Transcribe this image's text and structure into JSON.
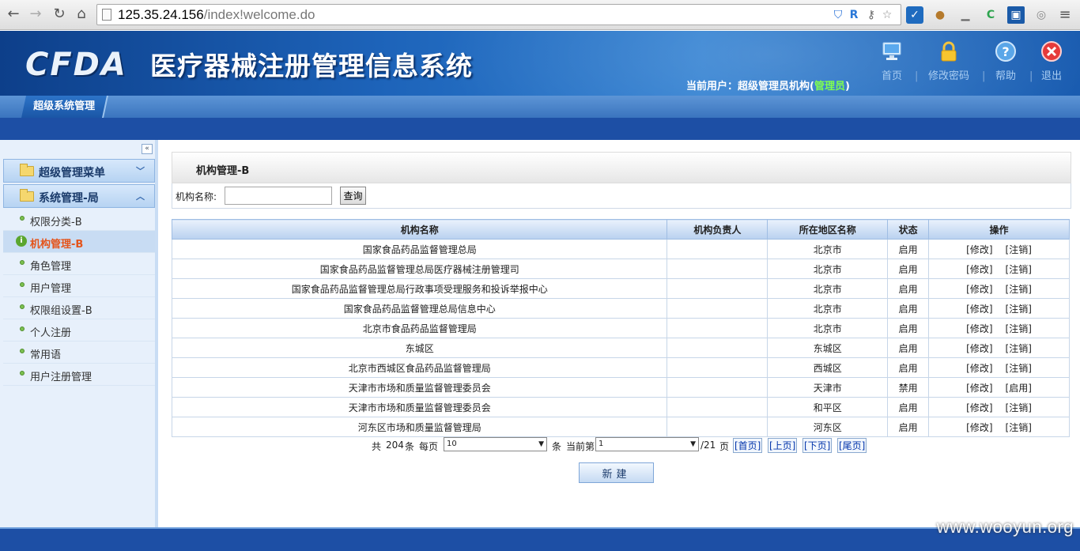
{
  "browser": {
    "url_host": "125.35.24.156",
    "url_path": "/index!welcome.do"
  },
  "header": {
    "logo": "CFDA",
    "system_title": "医疗器械注册管理信息系统",
    "current_user_label": "当前用户：",
    "current_user": "超级管理员机构",
    "role_open": "(",
    "role": "管理员",
    "role_close": ")",
    "toolbar": {
      "home": "首页",
      "change_password": "修改密码",
      "help": "帮助",
      "logout": "退出"
    }
  },
  "module_tab": "超级系统管理",
  "sidebar": {
    "collapse_glyph": "«",
    "groups": [
      {
        "label": "超级管理菜单",
        "state": "collapsed"
      },
      {
        "label": "系统管理-局",
        "state": "expanded"
      }
    ],
    "items": [
      {
        "label": "权限分类-B"
      },
      {
        "label": "机构管理-B"
      },
      {
        "label": "角色管理"
      },
      {
        "label": "用户管理"
      },
      {
        "label": "权限组设置-B"
      },
      {
        "label": "个人注册"
      },
      {
        "label": "常用语"
      },
      {
        "label": "用户注册管理"
      }
    ]
  },
  "main": {
    "panel_title": "机构管理-B",
    "search": {
      "label": "机构名称:",
      "value": "",
      "button": "查询"
    },
    "table": {
      "headers": [
        "机构名称",
        "机构负责人",
        "所在地区名称",
        "状态",
        "操作"
      ],
      "rows": [
        {
          "name": "国家食品药品监督管理总局",
          "owner": "",
          "region": "北京市",
          "status": "启用",
          "op1": "[修改]",
          "op2": "[注销]"
        },
        {
          "name": "国家食品药品监督管理总局医疗器械注册管理司",
          "owner": "",
          "region": "北京市",
          "status": "启用",
          "op1": "[修改]",
          "op2": "[注销]"
        },
        {
          "name": "国家食品药品监督管理总局行政事项受理服务和投诉举报中心",
          "owner": "",
          "region": "北京市",
          "status": "启用",
          "op1": "[修改]",
          "op2": "[注销]"
        },
        {
          "name": "国家食品药品监督管理总局信息中心",
          "owner": "",
          "region": "北京市",
          "status": "启用",
          "op1": "[修改]",
          "op2": "[注销]"
        },
        {
          "name": "北京市食品药品监督管理局",
          "owner": "",
          "region": "北京市",
          "status": "启用",
          "op1": "[修改]",
          "op2": "[注销]"
        },
        {
          "name": "东城区",
          "owner": "",
          "region": "东城区",
          "status": "启用",
          "op1": "[修改]",
          "op2": "[注销]"
        },
        {
          "name": "北京市西城区食品药品监督管理局",
          "owner": "",
          "region": "西城区",
          "status": "启用",
          "op1": "[修改]",
          "op2": "[注销]"
        },
        {
          "name": "天津市市场和质量监督管理委员会",
          "owner": "",
          "region": "天津市",
          "status": "禁用",
          "op1": "[修改]",
          "op2": "[启用]"
        },
        {
          "name": "天津市市场和质量监督管理委员会",
          "owner": "",
          "region": "和平区",
          "status": "启用",
          "op1": "[修改]",
          "op2": "[注销]"
        },
        {
          "name": "河东区市场和质量监督管理局",
          "owner": "",
          "region": "河东区",
          "status": "启用",
          "op1": "[修改]",
          "op2": "[注销]"
        }
      ]
    },
    "pager": {
      "total_prefix": "共",
      "total": "204",
      "total_unit": "条",
      "per_page_label": "每页",
      "per_page": "10",
      "per_page_unit": "条",
      "current_label": "当前第",
      "current": "1",
      "pages": "/21",
      "pages_unit": "页",
      "first": "[首页]",
      "prev": "[上页]",
      "next": "[下页]",
      "last": "[尾页]"
    },
    "new_button": "新建"
  },
  "watermark": "www.wooyun.org"
}
